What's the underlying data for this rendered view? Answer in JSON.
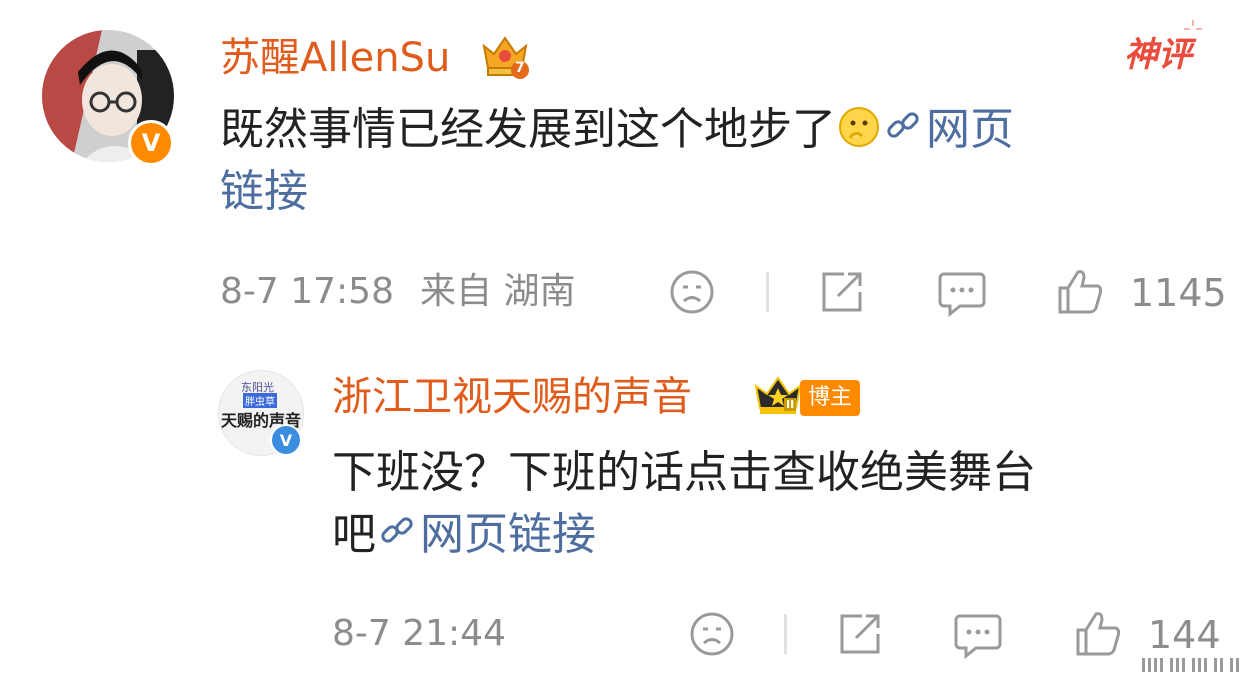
{
  "comment": {
    "author": "苏醒AllenSu",
    "level_badge": "7",
    "tag": "神评",
    "text": "既然事情已经发展到这个地步了",
    "link_label_part1": "网页",
    "link_label_part2": "链接",
    "time": "8-7 17:58",
    "location": "来自 湖南",
    "likes": "1145",
    "avatar_verified_mark": "V"
  },
  "reply": {
    "author": "浙江卫视天赐的声音",
    "rank_badge": "II",
    "author_badge": "博主",
    "text_line1": "下班没？下班的话点击查收绝美舞台",
    "text_line2": "吧",
    "link_label": "网页链接",
    "time": "8-7 21:44",
    "likes": "144",
    "avatar_verified_mark": "V",
    "avatar_logo_top": "东阳光",
    "avatar_logo_mid": "胖虫草",
    "avatar_logo_main": "天赐的声音"
  },
  "colors": {
    "author_name": "#e05c1c",
    "link": "#4f6ea0",
    "meta": "#8c8c8c",
    "badge_orange": "#ff8a00",
    "verified_blue": "#3b8de0"
  }
}
